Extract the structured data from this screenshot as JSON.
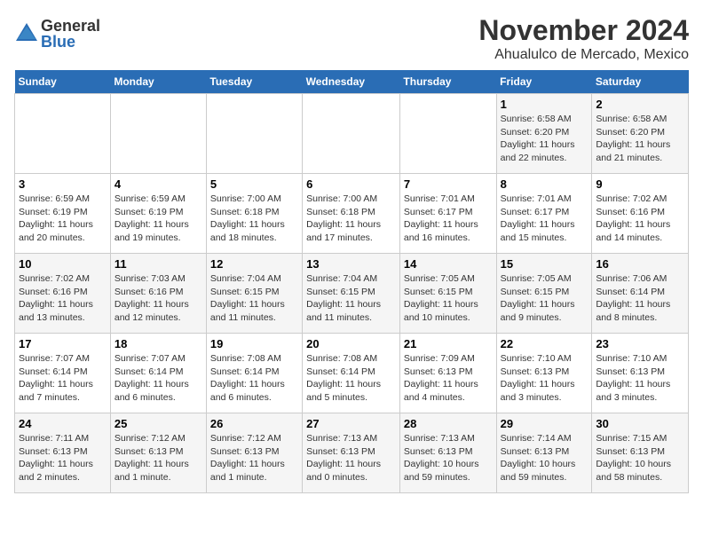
{
  "logo": {
    "general": "General",
    "blue": "Blue"
  },
  "title": "November 2024",
  "location": "Ahualulco de Mercado, Mexico",
  "days_of_week": [
    "Sunday",
    "Monday",
    "Tuesday",
    "Wednesday",
    "Thursday",
    "Friday",
    "Saturday"
  ],
  "weeks": [
    [
      {
        "day": "",
        "info": ""
      },
      {
        "day": "",
        "info": ""
      },
      {
        "day": "",
        "info": ""
      },
      {
        "day": "",
        "info": ""
      },
      {
        "day": "",
        "info": ""
      },
      {
        "day": "1",
        "info": "Sunrise: 6:58 AM\nSunset: 6:20 PM\nDaylight: 11 hours and 22 minutes."
      },
      {
        "day": "2",
        "info": "Sunrise: 6:58 AM\nSunset: 6:20 PM\nDaylight: 11 hours and 21 minutes."
      }
    ],
    [
      {
        "day": "3",
        "info": "Sunrise: 6:59 AM\nSunset: 6:19 PM\nDaylight: 11 hours and 20 minutes."
      },
      {
        "day": "4",
        "info": "Sunrise: 6:59 AM\nSunset: 6:19 PM\nDaylight: 11 hours and 19 minutes."
      },
      {
        "day": "5",
        "info": "Sunrise: 7:00 AM\nSunset: 6:18 PM\nDaylight: 11 hours and 18 minutes."
      },
      {
        "day": "6",
        "info": "Sunrise: 7:00 AM\nSunset: 6:18 PM\nDaylight: 11 hours and 17 minutes."
      },
      {
        "day": "7",
        "info": "Sunrise: 7:01 AM\nSunset: 6:17 PM\nDaylight: 11 hours and 16 minutes."
      },
      {
        "day": "8",
        "info": "Sunrise: 7:01 AM\nSunset: 6:17 PM\nDaylight: 11 hours and 15 minutes."
      },
      {
        "day": "9",
        "info": "Sunrise: 7:02 AM\nSunset: 6:16 PM\nDaylight: 11 hours and 14 minutes."
      }
    ],
    [
      {
        "day": "10",
        "info": "Sunrise: 7:02 AM\nSunset: 6:16 PM\nDaylight: 11 hours and 13 minutes."
      },
      {
        "day": "11",
        "info": "Sunrise: 7:03 AM\nSunset: 6:16 PM\nDaylight: 11 hours and 12 minutes."
      },
      {
        "day": "12",
        "info": "Sunrise: 7:04 AM\nSunset: 6:15 PM\nDaylight: 11 hours and 11 minutes."
      },
      {
        "day": "13",
        "info": "Sunrise: 7:04 AM\nSunset: 6:15 PM\nDaylight: 11 hours and 11 minutes."
      },
      {
        "day": "14",
        "info": "Sunrise: 7:05 AM\nSunset: 6:15 PM\nDaylight: 11 hours and 10 minutes."
      },
      {
        "day": "15",
        "info": "Sunrise: 7:05 AM\nSunset: 6:15 PM\nDaylight: 11 hours and 9 minutes."
      },
      {
        "day": "16",
        "info": "Sunrise: 7:06 AM\nSunset: 6:14 PM\nDaylight: 11 hours and 8 minutes."
      }
    ],
    [
      {
        "day": "17",
        "info": "Sunrise: 7:07 AM\nSunset: 6:14 PM\nDaylight: 11 hours and 7 minutes."
      },
      {
        "day": "18",
        "info": "Sunrise: 7:07 AM\nSunset: 6:14 PM\nDaylight: 11 hours and 6 minutes."
      },
      {
        "day": "19",
        "info": "Sunrise: 7:08 AM\nSunset: 6:14 PM\nDaylight: 11 hours and 6 minutes."
      },
      {
        "day": "20",
        "info": "Sunrise: 7:08 AM\nSunset: 6:14 PM\nDaylight: 11 hours and 5 minutes."
      },
      {
        "day": "21",
        "info": "Sunrise: 7:09 AM\nSunset: 6:13 PM\nDaylight: 11 hours and 4 minutes."
      },
      {
        "day": "22",
        "info": "Sunrise: 7:10 AM\nSunset: 6:13 PM\nDaylight: 11 hours and 3 minutes."
      },
      {
        "day": "23",
        "info": "Sunrise: 7:10 AM\nSunset: 6:13 PM\nDaylight: 11 hours and 3 minutes."
      }
    ],
    [
      {
        "day": "24",
        "info": "Sunrise: 7:11 AM\nSunset: 6:13 PM\nDaylight: 11 hours and 2 minutes."
      },
      {
        "day": "25",
        "info": "Sunrise: 7:12 AM\nSunset: 6:13 PM\nDaylight: 11 hours and 1 minute."
      },
      {
        "day": "26",
        "info": "Sunrise: 7:12 AM\nSunset: 6:13 PM\nDaylight: 11 hours and 1 minute."
      },
      {
        "day": "27",
        "info": "Sunrise: 7:13 AM\nSunset: 6:13 PM\nDaylight: 11 hours and 0 minutes."
      },
      {
        "day": "28",
        "info": "Sunrise: 7:13 AM\nSunset: 6:13 PM\nDaylight: 10 hours and 59 minutes."
      },
      {
        "day": "29",
        "info": "Sunrise: 7:14 AM\nSunset: 6:13 PM\nDaylight: 10 hours and 59 minutes."
      },
      {
        "day": "30",
        "info": "Sunrise: 7:15 AM\nSunset: 6:13 PM\nDaylight: 10 hours and 58 minutes."
      }
    ]
  ]
}
